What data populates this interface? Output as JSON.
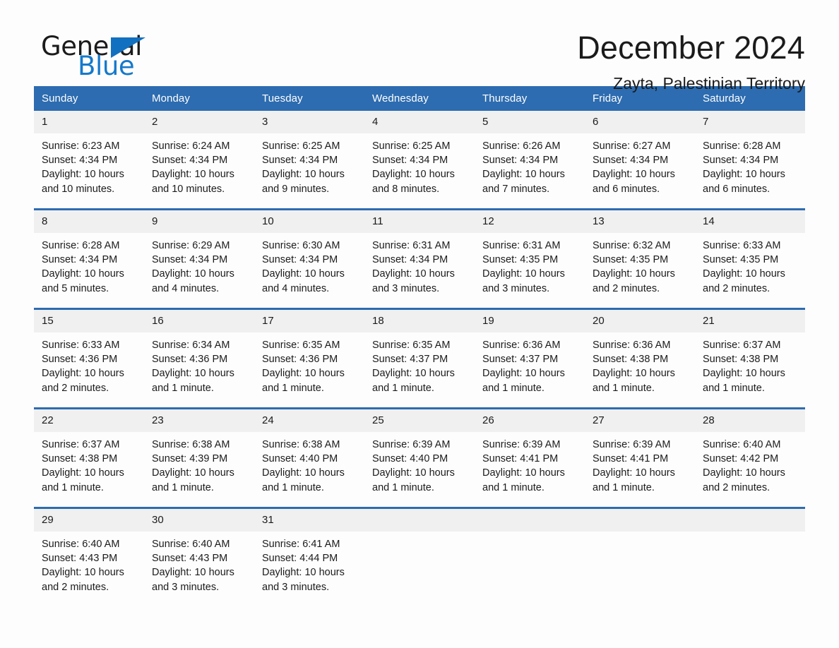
{
  "brand": {
    "word1": "General",
    "word2": "Blue",
    "triangle_color": "#1270c0",
    "blue_text_color": "#1579cb"
  },
  "header": {
    "title": "December 2024",
    "location": "Zayta, Palestinian Territory",
    "header_bg_color": "#2d6cb0",
    "daynum_bg_color": "#f0f0f0"
  },
  "weekday_headers": [
    "Sunday",
    "Monday",
    "Tuesday",
    "Wednesday",
    "Thursday",
    "Friday",
    "Saturday"
  ],
  "labels": {
    "sunrise": "Sunrise:",
    "sunset": "Sunset:",
    "daylight": "Daylight:"
  },
  "weeks": [
    [
      {
        "day": "1",
        "sunrise": "Sunrise: 6:23 AM",
        "sunset": "Sunset: 4:34 PM",
        "daylight_l1": "Daylight: 10 hours",
        "daylight_l2": "and 10 minutes."
      },
      {
        "day": "2",
        "sunrise": "Sunrise: 6:24 AM",
        "sunset": "Sunset: 4:34 PM",
        "daylight_l1": "Daylight: 10 hours",
        "daylight_l2": "and 10 minutes."
      },
      {
        "day": "3",
        "sunrise": "Sunrise: 6:25 AM",
        "sunset": "Sunset: 4:34 PM",
        "daylight_l1": "Daylight: 10 hours",
        "daylight_l2": "and 9 minutes."
      },
      {
        "day": "4",
        "sunrise": "Sunrise: 6:25 AM",
        "sunset": "Sunset: 4:34 PM",
        "daylight_l1": "Daylight: 10 hours",
        "daylight_l2": "and 8 minutes."
      },
      {
        "day": "5",
        "sunrise": "Sunrise: 6:26 AM",
        "sunset": "Sunset: 4:34 PM",
        "daylight_l1": "Daylight: 10 hours",
        "daylight_l2": "and 7 minutes."
      },
      {
        "day": "6",
        "sunrise": "Sunrise: 6:27 AM",
        "sunset": "Sunset: 4:34 PM",
        "daylight_l1": "Daylight: 10 hours",
        "daylight_l2": "and 6 minutes."
      },
      {
        "day": "7",
        "sunrise": "Sunrise: 6:28 AM",
        "sunset": "Sunset: 4:34 PM",
        "daylight_l1": "Daylight: 10 hours",
        "daylight_l2": "and 6 minutes."
      }
    ],
    [
      {
        "day": "8",
        "sunrise": "Sunrise: 6:28 AM",
        "sunset": "Sunset: 4:34 PM",
        "daylight_l1": "Daylight: 10 hours",
        "daylight_l2": "and 5 minutes."
      },
      {
        "day": "9",
        "sunrise": "Sunrise: 6:29 AM",
        "sunset": "Sunset: 4:34 PM",
        "daylight_l1": "Daylight: 10 hours",
        "daylight_l2": "and 4 minutes."
      },
      {
        "day": "10",
        "sunrise": "Sunrise: 6:30 AM",
        "sunset": "Sunset: 4:34 PM",
        "daylight_l1": "Daylight: 10 hours",
        "daylight_l2": "and 4 minutes."
      },
      {
        "day": "11",
        "sunrise": "Sunrise: 6:31 AM",
        "sunset": "Sunset: 4:34 PM",
        "daylight_l1": "Daylight: 10 hours",
        "daylight_l2": "and 3 minutes."
      },
      {
        "day": "12",
        "sunrise": "Sunrise: 6:31 AM",
        "sunset": "Sunset: 4:35 PM",
        "daylight_l1": "Daylight: 10 hours",
        "daylight_l2": "and 3 minutes."
      },
      {
        "day": "13",
        "sunrise": "Sunrise: 6:32 AM",
        "sunset": "Sunset: 4:35 PM",
        "daylight_l1": "Daylight: 10 hours",
        "daylight_l2": "and 2 minutes."
      },
      {
        "day": "14",
        "sunrise": "Sunrise: 6:33 AM",
        "sunset": "Sunset: 4:35 PM",
        "daylight_l1": "Daylight: 10 hours",
        "daylight_l2": "and 2 minutes."
      }
    ],
    [
      {
        "day": "15",
        "sunrise": "Sunrise: 6:33 AM",
        "sunset": "Sunset: 4:36 PM",
        "daylight_l1": "Daylight: 10 hours",
        "daylight_l2": "and 2 minutes."
      },
      {
        "day": "16",
        "sunrise": "Sunrise: 6:34 AM",
        "sunset": "Sunset: 4:36 PM",
        "daylight_l1": "Daylight: 10 hours",
        "daylight_l2": "and 1 minute."
      },
      {
        "day": "17",
        "sunrise": "Sunrise: 6:35 AM",
        "sunset": "Sunset: 4:36 PM",
        "daylight_l1": "Daylight: 10 hours",
        "daylight_l2": "and 1 minute."
      },
      {
        "day": "18",
        "sunrise": "Sunrise: 6:35 AM",
        "sunset": "Sunset: 4:37 PM",
        "daylight_l1": "Daylight: 10 hours",
        "daylight_l2": "and 1 minute."
      },
      {
        "day": "19",
        "sunrise": "Sunrise: 6:36 AM",
        "sunset": "Sunset: 4:37 PM",
        "daylight_l1": "Daylight: 10 hours",
        "daylight_l2": "and 1 minute."
      },
      {
        "day": "20",
        "sunrise": "Sunrise: 6:36 AM",
        "sunset": "Sunset: 4:38 PM",
        "daylight_l1": "Daylight: 10 hours",
        "daylight_l2": "and 1 minute."
      },
      {
        "day": "21",
        "sunrise": "Sunrise: 6:37 AM",
        "sunset": "Sunset: 4:38 PM",
        "daylight_l1": "Daylight: 10 hours",
        "daylight_l2": "and 1 minute."
      }
    ],
    [
      {
        "day": "22",
        "sunrise": "Sunrise: 6:37 AM",
        "sunset": "Sunset: 4:38 PM",
        "daylight_l1": "Daylight: 10 hours",
        "daylight_l2": "and 1 minute."
      },
      {
        "day": "23",
        "sunrise": "Sunrise: 6:38 AM",
        "sunset": "Sunset: 4:39 PM",
        "daylight_l1": "Daylight: 10 hours",
        "daylight_l2": "and 1 minute."
      },
      {
        "day": "24",
        "sunrise": "Sunrise: 6:38 AM",
        "sunset": "Sunset: 4:40 PM",
        "daylight_l1": "Daylight: 10 hours",
        "daylight_l2": "and 1 minute."
      },
      {
        "day": "25",
        "sunrise": "Sunrise: 6:39 AM",
        "sunset": "Sunset: 4:40 PM",
        "daylight_l1": "Daylight: 10 hours",
        "daylight_l2": "and 1 minute."
      },
      {
        "day": "26",
        "sunrise": "Sunrise: 6:39 AM",
        "sunset": "Sunset: 4:41 PM",
        "daylight_l1": "Daylight: 10 hours",
        "daylight_l2": "and 1 minute."
      },
      {
        "day": "27",
        "sunrise": "Sunrise: 6:39 AM",
        "sunset": "Sunset: 4:41 PM",
        "daylight_l1": "Daylight: 10 hours",
        "daylight_l2": "and 1 minute."
      },
      {
        "day": "28",
        "sunrise": "Sunrise: 6:40 AM",
        "sunset": "Sunset: 4:42 PM",
        "daylight_l1": "Daylight: 10 hours",
        "daylight_l2": "and 2 minutes."
      }
    ],
    [
      {
        "day": "29",
        "sunrise": "Sunrise: 6:40 AM",
        "sunset": "Sunset: 4:43 PM",
        "daylight_l1": "Daylight: 10 hours",
        "daylight_l2": "and 2 minutes."
      },
      {
        "day": "30",
        "sunrise": "Sunrise: 6:40 AM",
        "sunset": "Sunset: 4:43 PM",
        "daylight_l1": "Daylight: 10 hours",
        "daylight_l2": "and 3 minutes."
      },
      {
        "day": "31",
        "sunrise": "Sunrise: 6:41 AM",
        "sunset": "Sunset: 4:44 PM",
        "daylight_l1": "Daylight: 10 hours",
        "daylight_l2": "and 3 minutes."
      },
      {
        "day": "",
        "sunrise": "",
        "sunset": "",
        "daylight_l1": "",
        "daylight_l2": ""
      },
      {
        "day": "",
        "sunrise": "",
        "sunset": "",
        "daylight_l1": "",
        "daylight_l2": ""
      },
      {
        "day": "",
        "sunrise": "",
        "sunset": "",
        "daylight_l1": "",
        "daylight_l2": ""
      },
      {
        "day": "",
        "sunrise": "",
        "sunset": "",
        "daylight_l1": "",
        "daylight_l2": ""
      }
    ]
  ]
}
